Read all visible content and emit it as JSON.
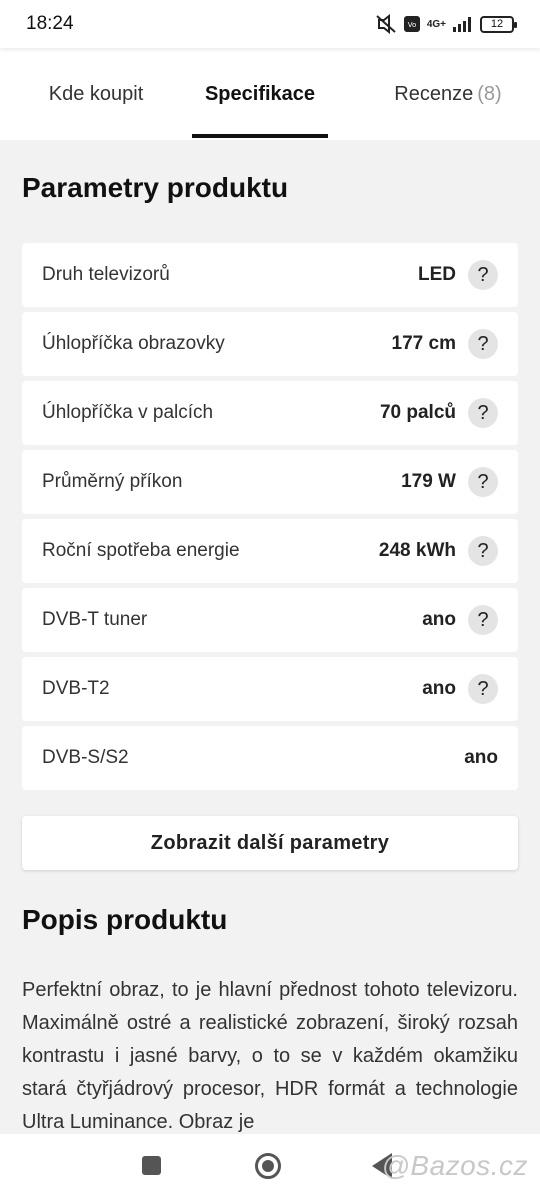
{
  "status": {
    "time": "18:24",
    "battery": "12",
    "network": "4G+"
  },
  "tabs": [
    {
      "label": "Kde koupit"
    },
    {
      "label": "Specifikace"
    },
    {
      "label": "Recenze",
      "count": "(8)"
    }
  ],
  "params": {
    "title": "Parametry produktu",
    "rows": [
      {
        "label": "Druh televizorů",
        "value": "LED",
        "help": "?"
      },
      {
        "label": "Úhlopříčka obrazovky",
        "value": "177 cm",
        "help": "?"
      },
      {
        "label": "Úhlopříčka v palcích",
        "value": "70 palců",
        "help": "?"
      },
      {
        "label": "Průměrný příkon",
        "value": "179 W",
        "help": "?"
      },
      {
        "label": "Roční spotřeba energie",
        "value": "248 kWh",
        "help": "?"
      },
      {
        "label": "DVB-T tuner",
        "value": "ano",
        "help": "?"
      },
      {
        "label": "DVB-T2",
        "value": "ano",
        "help": "?"
      },
      {
        "label": "DVB-S/S2",
        "value": "ano"
      }
    ],
    "more_button": "Zobrazit další parametry"
  },
  "description": {
    "title": "Popis produktu",
    "text": "Perfektní obraz, to je hlavní přednost tohoto televizoru. Maximálně ostré a realistické zobrazení, široký rozsah kontrastu i jasné barvy, o to se v každém okamžiku stará čtyřjádrový procesor, HDR formát a technologie Ultra Luminance. Obraz je"
  },
  "watermark": "@Bazos.cz"
}
